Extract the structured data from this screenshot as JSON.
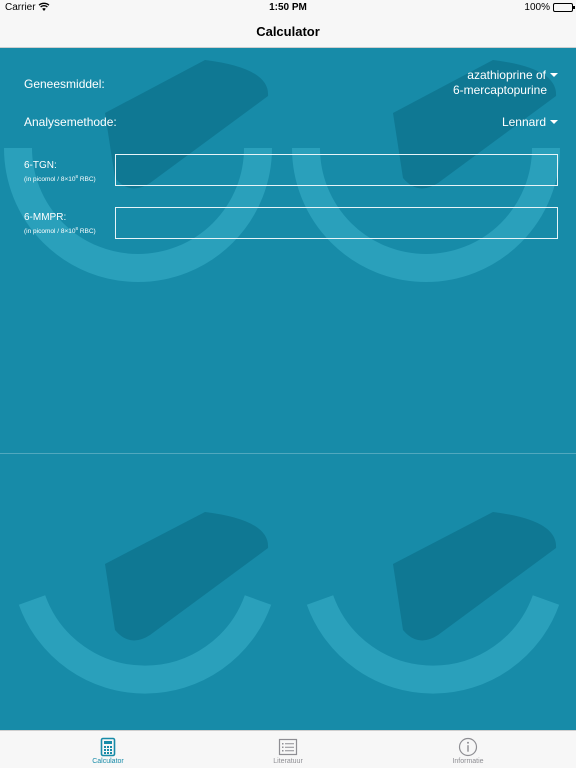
{
  "status_bar": {
    "carrier": "Carrier",
    "time": "1:50 PM",
    "battery": "100%"
  },
  "nav": {
    "title": "Calculator"
  },
  "form": {
    "drug": {
      "label": "Geneesmiddel:",
      "value_line1": "azathioprine of",
      "value_line2": "6-mercaptopurine"
    },
    "method": {
      "label": "Analysemethode:",
      "value": "Lennard"
    },
    "tgn": {
      "label": "6-TGN:",
      "unit_prefix": "(in picomol / 8×10",
      "unit_exp": "8",
      "unit_suffix": " RBC)",
      "value": ""
    },
    "mmpr": {
      "label": "6-MMPR:",
      "unit_prefix": "(in picomol / 8×10",
      "unit_exp": "8",
      "unit_suffix": " RBC)",
      "value": ""
    }
  },
  "tabs": [
    {
      "label": "Calculator",
      "icon": "calculator-icon",
      "active": true
    },
    {
      "label": "Literatuur",
      "icon": "list-icon",
      "active": false
    },
    {
      "label": "Informatie",
      "icon": "info-icon",
      "active": false
    }
  ],
  "colors": {
    "background": "#178ba8",
    "accent": "#178ba8",
    "bars": "#f7f7f7",
    "inactive_tab": "#8e8e93"
  }
}
